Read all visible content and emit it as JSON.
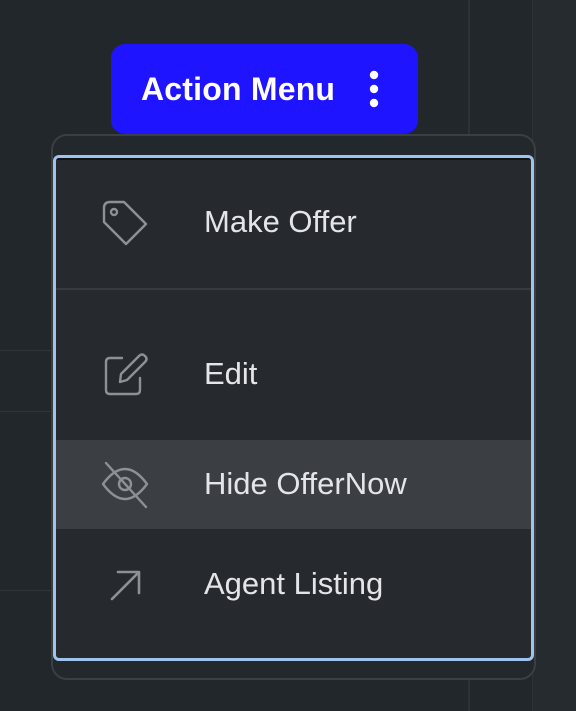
{
  "action_button": {
    "label": "Action Menu",
    "icon": "kebab-vertical-icon",
    "color": "#1f14ff"
  },
  "menu": {
    "items": [
      {
        "label": "Make Offer",
        "icon": "tag-icon"
      },
      {
        "label": "Edit",
        "icon": "edit-icon"
      },
      {
        "label": "Hide OfferNow",
        "icon": "eye-off-icon",
        "state": "hovered"
      },
      {
        "label": "Agent Listing",
        "icon": "arrow-up-right-icon"
      }
    ],
    "focus_ring_color": "#9fc3ee"
  }
}
